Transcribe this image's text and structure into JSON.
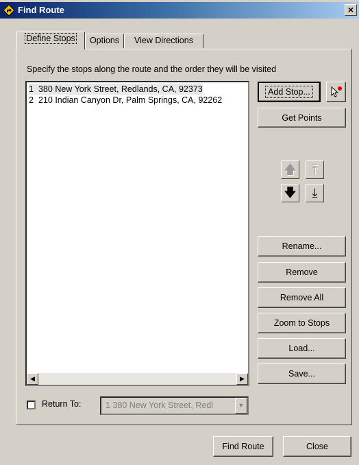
{
  "window": {
    "title": "Find Route",
    "close_glyph": "×",
    "icon": "route-sign-icon"
  },
  "tabs": [
    {
      "label": "Define Stops",
      "active": true
    },
    {
      "label": "Options",
      "active": false
    },
    {
      "label": "View Directions",
      "active": false
    }
  ],
  "instructions": "Specify the stops along the route and the order they will be visited",
  "stops": [
    {
      "num": "1",
      "address": "380 New York Street, Redlands, CA, 92373",
      "selected": true
    },
    {
      "num": "2",
      "address": "210 Indian Canyon Dr, Palm Springs, CA, 92262",
      "selected": false
    }
  ],
  "buttons": {
    "add_stop": "Add Stop...",
    "get_points": "Get Points",
    "rename": "Rename...",
    "remove": "Remove",
    "remove_all": "Remove All",
    "zoom_to_stops": "Zoom to Stops",
    "load": "Load...",
    "save": "Save...",
    "find_route": "Find Route",
    "close": "Close"
  },
  "order_buttons": {
    "move_up": {
      "glyph": "🡅",
      "enabled": false
    },
    "move_to_top": {
      "glyph": "⤒",
      "enabled": false
    },
    "move_down": {
      "glyph": "🡇",
      "enabled": true
    },
    "move_to_bottom": {
      "glyph": "⤓",
      "enabled": true
    }
  },
  "return_to": {
    "label": "Return To:",
    "checked": false,
    "value": "1   380 New York Street, Redl",
    "enabled": false
  },
  "colors": {
    "title_start": "#0a246a",
    "title_end": "#a6caf0",
    "face": "#d4d0c8",
    "cursor_dot": "#e00000"
  }
}
